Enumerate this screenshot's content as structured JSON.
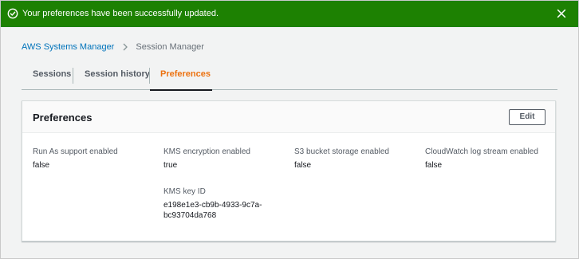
{
  "flash": {
    "message": "Your preferences have been successfully updated.",
    "type": "success",
    "color": "#1d8102",
    "status_icon": "check-circle-icon",
    "dismiss_icon": "close-icon"
  },
  "breadcrumb": {
    "parent": "AWS Systems Manager",
    "separator_icon": "chevron-right-icon",
    "current": "Session Manager"
  },
  "tabs": [
    {
      "label": "Sessions",
      "active": false
    },
    {
      "label": "Session history",
      "active": false
    },
    {
      "label": "Preferences",
      "active": true
    }
  ],
  "accent_color": "#ec7211",
  "link_color": "#0073bb",
  "panel": {
    "title": "Preferences",
    "edit_label": "Edit",
    "fields": [
      {
        "label": "Run As support enabled",
        "value": "false"
      },
      {
        "label": "KMS encryption enabled",
        "value": "true"
      },
      {
        "label": "S3 bucket storage enabled",
        "value": "false"
      },
      {
        "label": "CloudWatch log stream enabled",
        "value": "false"
      },
      {
        "label": "KMS key ID",
        "value": "e198e1e3-cb9b-4933-9c7a-bc93704da768"
      }
    ]
  }
}
